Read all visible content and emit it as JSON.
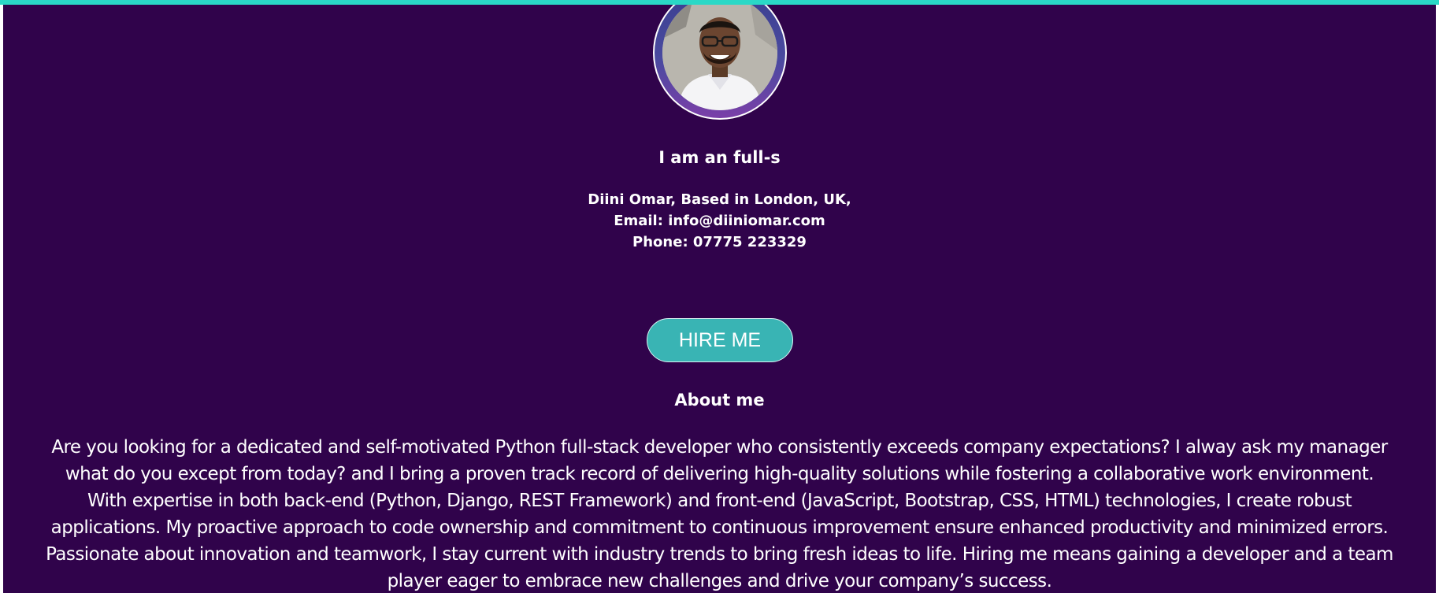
{
  "colors": {
    "accent_bar": "#2ad8c6",
    "page_background": "#30034b",
    "button_background": "#39b4b4",
    "text": "#ffffff"
  },
  "profile": {
    "avatar_icon": "profile-photo",
    "tagline": "I am an full-s",
    "name_location": "Diini Omar, Based in London, UK,",
    "email": "Email: info@diiniomar.com",
    "phone": "Phone: 07775 223329"
  },
  "actions": {
    "hire_label": "HIRE ME"
  },
  "about": {
    "title": "About me",
    "lines": [
      "Are you looking for a dedicated and self-motivated Python full-stack developer who consistently exceeds company expectations? I alway ask my manager",
      "what do you except from today? and I bring a proven track record of delivering high-quality solutions while fostering a collaborative work environment.",
      "With expertise in both back-end (Python, Django, REST Framework) and front-end (JavaScript, Bootstrap, CSS, HTML) technologies, I create robust",
      "applications. My proactive approach to code ownership and commitment to continuous improvement ensure enhanced productivity and minimized errors.",
      "Passionate about innovation and teamwork, I stay current with industry trends to bring fresh ideas to life. Hiring me means gaining a developer and a team",
      "player eager to embrace new challenges and drive your company’s success."
    ]
  }
}
